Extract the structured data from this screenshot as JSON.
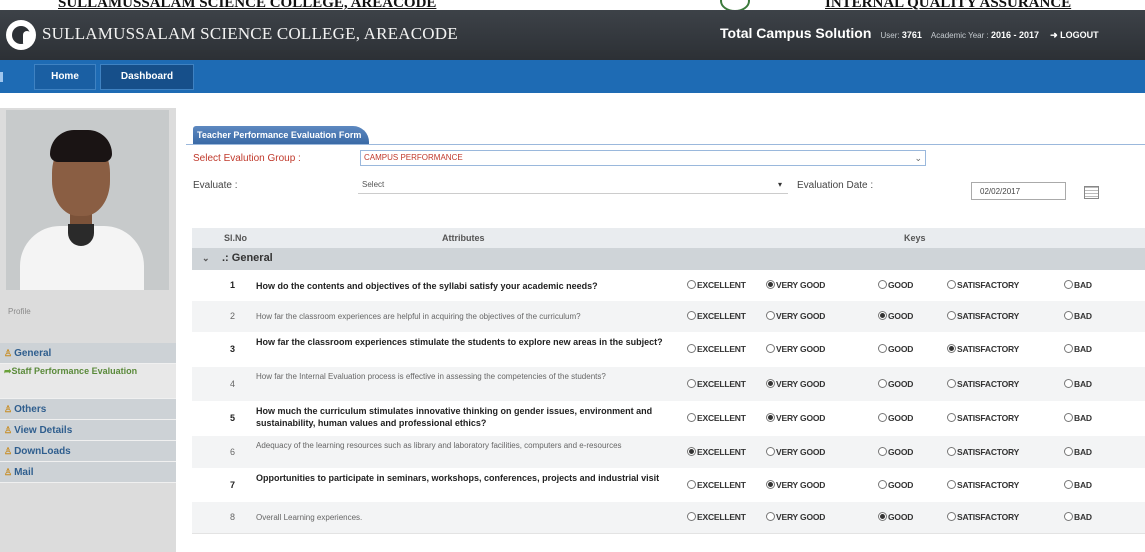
{
  "banner": {
    "left_text": "SULLAMUSSALAM SCIENCE COLLEGE, AREACODE",
    "right_text": "INTERNAL QUALITY ASSURANCE"
  },
  "header": {
    "college_name": "SULLAMUSSALAM SCIENCE COLLEGE, AREACODE",
    "product": "Total Campus Solution",
    "user_label": "User:",
    "user_id": "3761",
    "year_label": "Academic Year :",
    "year_value": "2016 - 2017",
    "logout_label": "LOGOUT",
    "logout_icon": "arrow-right-icon"
  },
  "nav": {
    "home": "Home",
    "dashboard": "Dashboard"
  },
  "sidebar": {
    "profile_label": "Profile",
    "menu": [
      {
        "label": "General",
        "icon": "person-icon"
      },
      {
        "label": "Staff Performance Evaluation",
        "icon": "share-arrow-icon"
      },
      {
        "label": "Others",
        "icon": "person-icon"
      },
      {
        "label": "View Details",
        "icon": "person-icon"
      },
      {
        "label": "DownLoads",
        "icon": "person-icon"
      },
      {
        "label": "Mail",
        "icon": "person-icon"
      }
    ]
  },
  "form": {
    "tab_title": "Teacher Performance Evaluation Form",
    "group_label": "Select Evalution Group :",
    "group_value": "CAMPUS PERFORMANCE",
    "evaluate_label": "Evaluate :",
    "evaluate_value": "Select",
    "date_label": "Evaluation Date :",
    "date_value": "02/02/2017"
  },
  "table": {
    "columns": {
      "slno": "Sl.No",
      "attributes": "Attributes",
      "keys": "Keys"
    },
    "group_name": ".: General",
    "options": [
      "EXCELLENT",
      "VERY GOOD",
      "GOOD",
      "SATISFACTORY",
      "BAD"
    ],
    "rows": [
      {
        "sl": "1",
        "question": "How do the contents and objectives of the syllabi satisfy your academic needs?",
        "selected": "VERY GOOD"
      },
      {
        "sl": "2",
        "question": "How far the classroom experiences are helpful in acquiring the objectives of the curriculum?",
        "selected": "GOOD"
      },
      {
        "sl": "3",
        "question": "How far the classroom experiences stimulate the students to explore new areas in the subject?",
        "selected": "SATISFACTORY"
      },
      {
        "sl": "4",
        "question": "How far the Internal Evaluation process is effective in assessing the competencies of the students?",
        "selected": "VERY GOOD"
      },
      {
        "sl": "5",
        "question": "How much the curriculum stimulates innovative thinking on gender issues, environment and sustainability, human values and professional ethics?",
        "selected": "VERY GOOD"
      },
      {
        "sl": "6",
        "question": "Adequacy of the learning resources such as library and laboratory facilities, computers and e-resources",
        "selected": "EXCELLENT"
      },
      {
        "sl": "7",
        "question": "Opportunities to participate in seminars, workshops, conferences, projects and industrial visit",
        "selected": "VERY GOOD"
      },
      {
        "sl": "8",
        "question": "Overall Learning experiences.",
        "selected": "GOOD"
      }
    ]
  }
}
